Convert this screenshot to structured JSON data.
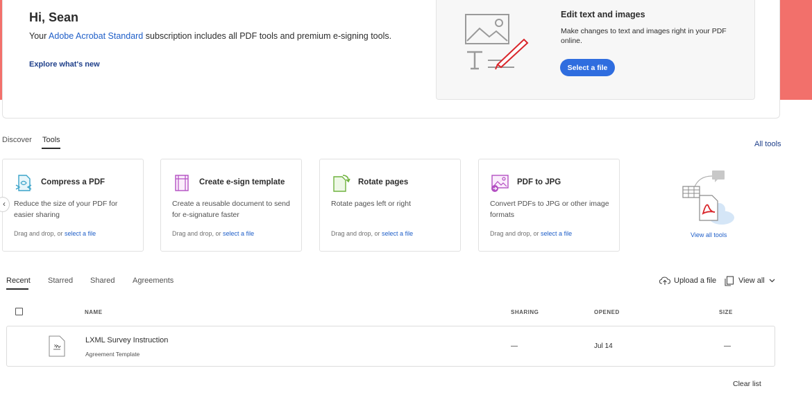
{
  "hero": {
    "greeting": "Hi, Sean",
    "sub_prefix": "Your ",
    "sub_link": "Adobe Acrobat Standard",
    "sub_suffix": " subscription includes all PDF tools and premium e-signing tools.",
    "explore": "Explore what's new"
  },
  "promo": {
    "title": "Edit text and images",
    "description": "Make changes to text and images right in your PDF online.",
    "button": "Select a file"
  },
  "top_tabs": [
    {
      "label": "Discover",
      "active": false
    },
    {
      "label": "Tools",
      "active": true
    }
  ],
  "all_tools": "All tools",
  "drag_text": "Drag and drop, or ",
  "select_text": "select a file",
  "tools": [
    {
      "title": "Compress a PDF",
      "description": "Reduce the size of your PDF for easier sharing",
      "icon": "compress-icon"
    },
    {
      "title": "Create e-sign template",
      "description": "Create a reusable document to send for e-signature faster",
      "icon": "template-icon"
    },
    {
      "title": "Rotate pages",
      "description": "Rotate pages left or right",
      "icon": "rotate-icon"
    },
    {
      "title": "PDF to JPG",
      "description": "Convert PDFs to JPG or other image formats",
      "icon": "image-convert-icon"
    }
  ],
  "carousel_prev": "‹",
  "view_all_tools": "View all tools",
  "recent_tabs": [
    {
      "label": "Recent",
      "active": true
    },
    {
      "label": "Starred",
      "active": false
    },
    {
      "label": "Shared",
      "active": false
    },
    {
      "label": "Agreements",
      "active": false
    }
  ],
  "upload": "Upload a file",
  "view_all": "View all",
  "columns": {
    "name": "NAME",
    "sharing": "SHARING",
    "opened": "OPENED",
    "size": "SIZE"
  },
  "files": [
    {
      "name": "LXML Survey Instruction",
      "type": "Agreement Template",
      "sharing": "—",
      "opened": "Jul 14",
      "size": "—"
    }
  ],
  "clear_list": "Clear list",
  "colors": {
    "accent": "#2f6ddf",
    "hero_red": "#f2706b",
    "link": "#1e5ec8"
  }
}
